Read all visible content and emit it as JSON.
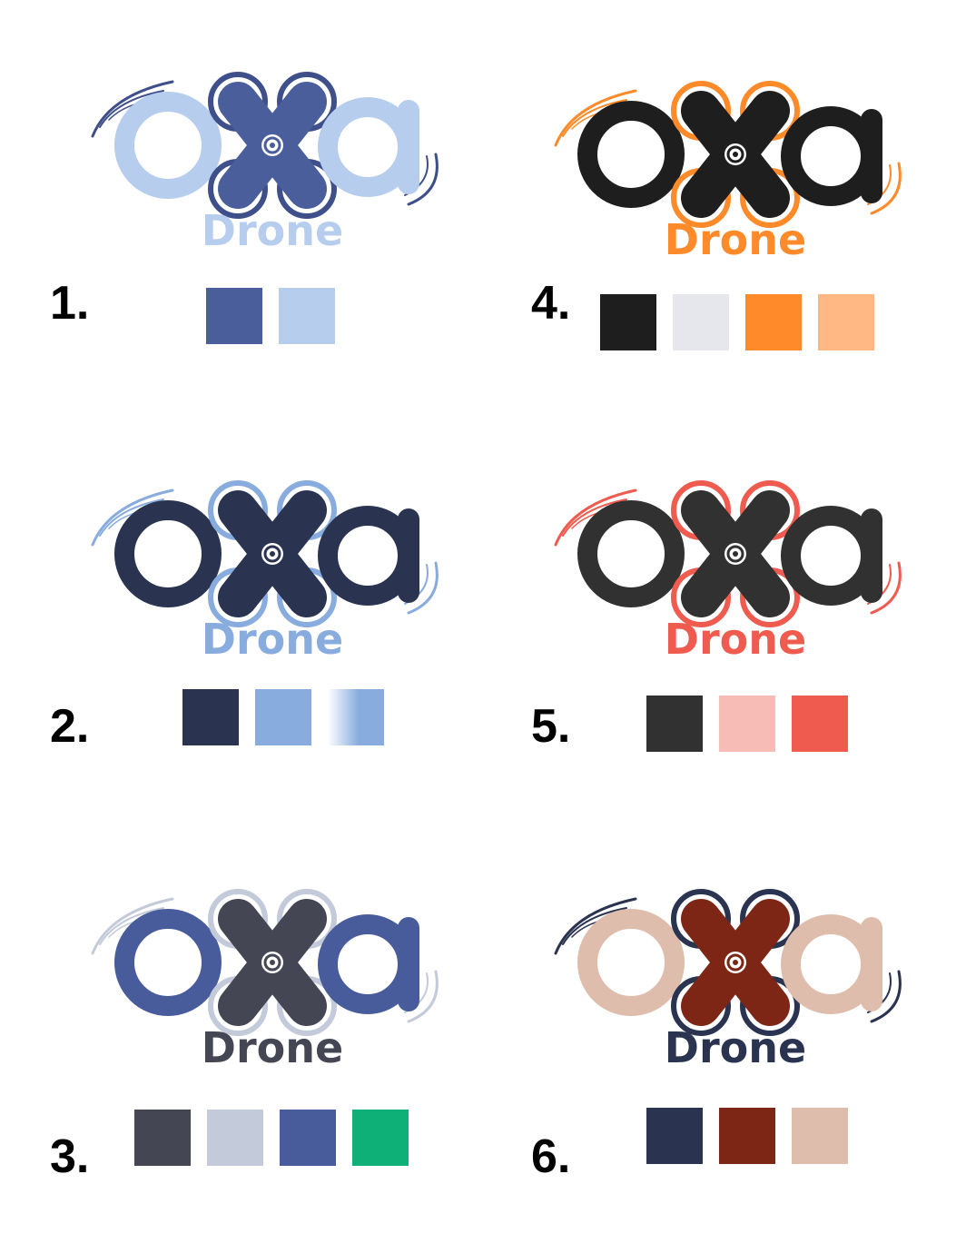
{
  "variants": [
    {
      "number": "1.",
      "logo": {
        "wordmark": "oxa",
        "tagline": "Drone",
        "letter_color": "#b6cdee",
        "x_color": "#4a5e9c",
        "rotor_color": "#3f4f8a",
        "rotor_inner_color": "#b6cdee",
        "swoosh_color": "#3f4f8a",
        "tagline_color": "#b6cdee"
      },
      "swatches": [
        "#4a5e9c",
        "#b6cdee"
      ]
    },
    {
      "number": "2.",
      "logo": {
        "wordmark": "oxa",
        "tagline": "Drone",
        "letter_color": "#2a3350",
        "x_color": "#2a3350",
        "rotor_color": "#88acde",
        "rotor_inner_color": "#c7d8f2",
        "swoosh_color": "#88acde",
        "tagline_color": "#88acde"
      },
      "swatches": [
        "#2a3350",
        "#88acde",
        "gradient:#88acde"
      ]
    },
    {
      "number": "3.",
      "logo": {
        "wordmark": "oxa",
        "tagline": "Drone",
        "letter_color": "#485b9a",
        "x_color": "#444653",
        "rotor_color": "#c3cad9",
        "rotor_inner_color": "#dde2ec",
        "swoosh_color": "#c3cad9",
        "tagline_color": "#444653"
      },
      "swatches": [
        "#444653",
        "#c3cad9",
        "#485b9a",
        "#0faf78"
      ]
    },
    {
      "number": "4.",
      "logo": {
        "wordmark": "oxa",
        "tagline": "Drone",
        "letter_color": "#1e1e1e",
        "x_color": "#1e1e1e",
        "rotor_color": "#ff8a2a",
        "rotor_inner_color": "#ffb884",
        "swoosh_color": "#ff8a2a",
        "tagline_color": "#ff8a2a"
      },
      "swatches": [
        "#1e1e1e",
        "#e6e7ec",
        "#ff8a2a",
        "#ffb884"
      ]
    },
    {
      "number": "5.",
      "logo": {
        "wordmark": "oxa",
        "tagline": "Drone",
        "letter_color": "#313131",
        "x_color": "#313131",
        "rotor_color": "#ef5b4f",
        "rotor_inner_color": "#f7bcb6",
        "swoosh_color": "#ef5b4f",
        "tagline_color": "#ef5b4f"
      },
      "swatches": [
        "#313131",
        "#f7bcb6",
        "#ef5b4f"
      ]
    },
    {
      "number": "6.",
      "logo": {
        "wordmark": "oxa",
        "tagline": "Drone",
        "letter_color": "#dfbdac",
        "x_color": "#7e2615",
        "rotor_color": "#2a3350",
        "rotor_inner_color": "#7e2615",
        "swoosh_color": "#2a3350",
        "tagline_color": "#2a3350"
      },
      "swatches": [
        "#2a3350",
        "#7e2615",
        "#dfbdac"
      ]
    }
  ]
}
